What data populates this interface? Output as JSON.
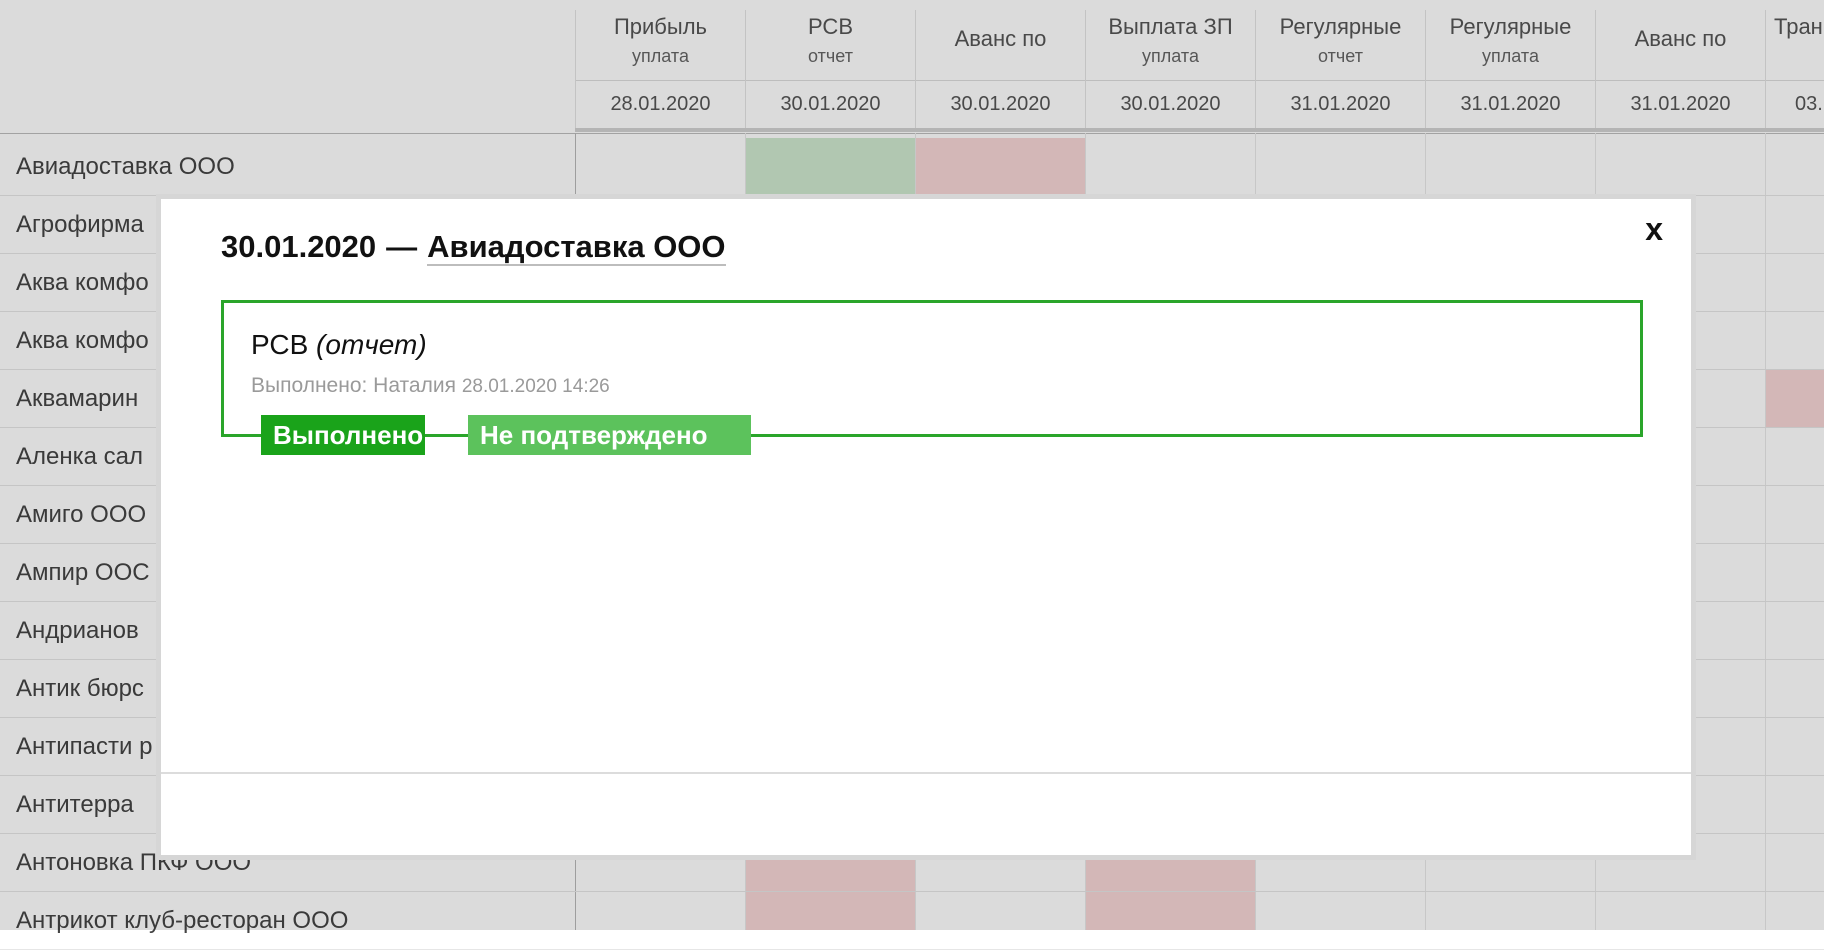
{
  "columns": [
    {
      "name": "Прибыль",
      "sub": "уплата",
      "date": "28.01.2020"
    },
    {
      "name": "РСВ",
      "sub": "отчет",
      "date": "30.01.2020"
    },
    {
      "name": "Аванс по",
      "sub": "",
      "date": "30.01.2020"
    },
    {
      "name": "Выплата ЗП",
      "sub": "уплата",
      "date": "30.01.2020"
    },
    {
      "name": "Регулярные",
      "sub": "отчет",
      "date": "31.01.2020"
    },
    {
      "name": "Регулярные",
      "sub": "уплата",
      "date": "31.01.2020"
    },
    {
      "name": "Аванс по",
      "sub": "",
      "date": "31.01.2020"
    },
    {
      "name": "Тран",
      "sub": "",
      "date": "03."
    }
  ],
  "companies": [
    "Авиадоставка ООО",
    "Агрофирма",
    "Аква комфо",
    "Аква комфо",
    "Аквамарин",
    "Аленка сал",
    "Амиго ООО",
    "Ампир ООС",
    "Андрианов",
    "Антик бюрс",
    "Антипасти р",
    "Антитерра",
    "Антоновка ПКФ ООО",
    "Антрикот клуб-ресторан ООО"
  ],
  "colors": {
    "done": "#1aa31a",
    "pending": "#5cc25c",
    "card_border": "#2aa52a",
    "cell_green": "#cfe8cf",
    "cell_red": "#f6d6d6"
  },
  "modal": {
    "date": "30.01.2020",
    "separator": "—",
    "company": "Авиадоставка ООО",
    "close_label": "x",
    "task": {
      "name": "РСВ",
      "kind": "(отчет)",
      "meta_label": "Выполнено: Наталия",
      "timestamp": "28.01.2020 14:26"
    },
    "badges": {
      "done": "Выполнено",
      "pending": "Не подтверждено"
    }
  }
}
